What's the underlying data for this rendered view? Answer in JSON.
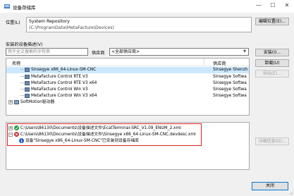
{
  "window": {
    "title": "设备存储库",
    "minimize": "—",
    "maximize": "☐",
    "close": "✕"
  },
  "location": {
    "label": "位置(L)",
    "value": "System Repository",
    "path": "(C:\\ProgramData\\MetaFacture\\Devices)",
    "edit_button": "编辑位置(E)..."
  },
  "desc_section": {
    "label": "安装的设备描述(V)"
  },
  "search": {
    "placeholder": "用于全文搜索的字符串"
  },
  "vendor": {
    "label": "供应商",
    "value": "<全部供应商>"
  },
  "tree": {
    "header_name": "名称",
    "header_vendor": "供应商",
    "rows": [
      {
        "name": "Sinsegye x86_64-Linux-SM-CNC",
        "vendor": "Sinsegye Shenzh"
      },
      {
        "name": "MetaFacture Control RTE V3",
        "vendor": "Sinsegye Softwa"
      },
      {
        "name": "MetaFacture Control RTE V3 x64",
        "vendor": "Sinsegye Softwa"
      },
      {
        "name": "MetaFacture Control Win V3",
        "vendor": "Sinsegye Softwa"
      },
      {
        "name": "MetaFacture Control Win V3 x64",
        "vendor": "Sinsegye Softwa"
      },
      {
        "name": "SoftMotion驱动器",
        "vendor": ""
      }
    ]
  },
  "side_buttons": {
    "install": "安装(I)...",
    "uninstall": "卸载(U)",
    "export": "导出(E)...",
    "details": "详细信息(D)..."
  },
  "log": {
    "file1": "C:\\Users\\86130\\Documents\\设备描述文件\\EcatTerminal-SRC_V1.09_ENUM_2.xml",
    "file2": "C:\\Users\\86130\\Documents\\设备描述文件\\Sinsegye x86_64-Linux-SM-CNC.devdesc.xml",
    "message": "设备\"Sinsegye x86_64-Linux-SM-CNC\"已安装到设备存储库"
  },
  "footer": {
    "close_button": "关闭"
  },
  "colors": {
    "highlight": "#e0201c",
    "success": "#1e9b3a",
    "error": "#d32f2f",
    "info": "#1e5fc8"
  }
}
